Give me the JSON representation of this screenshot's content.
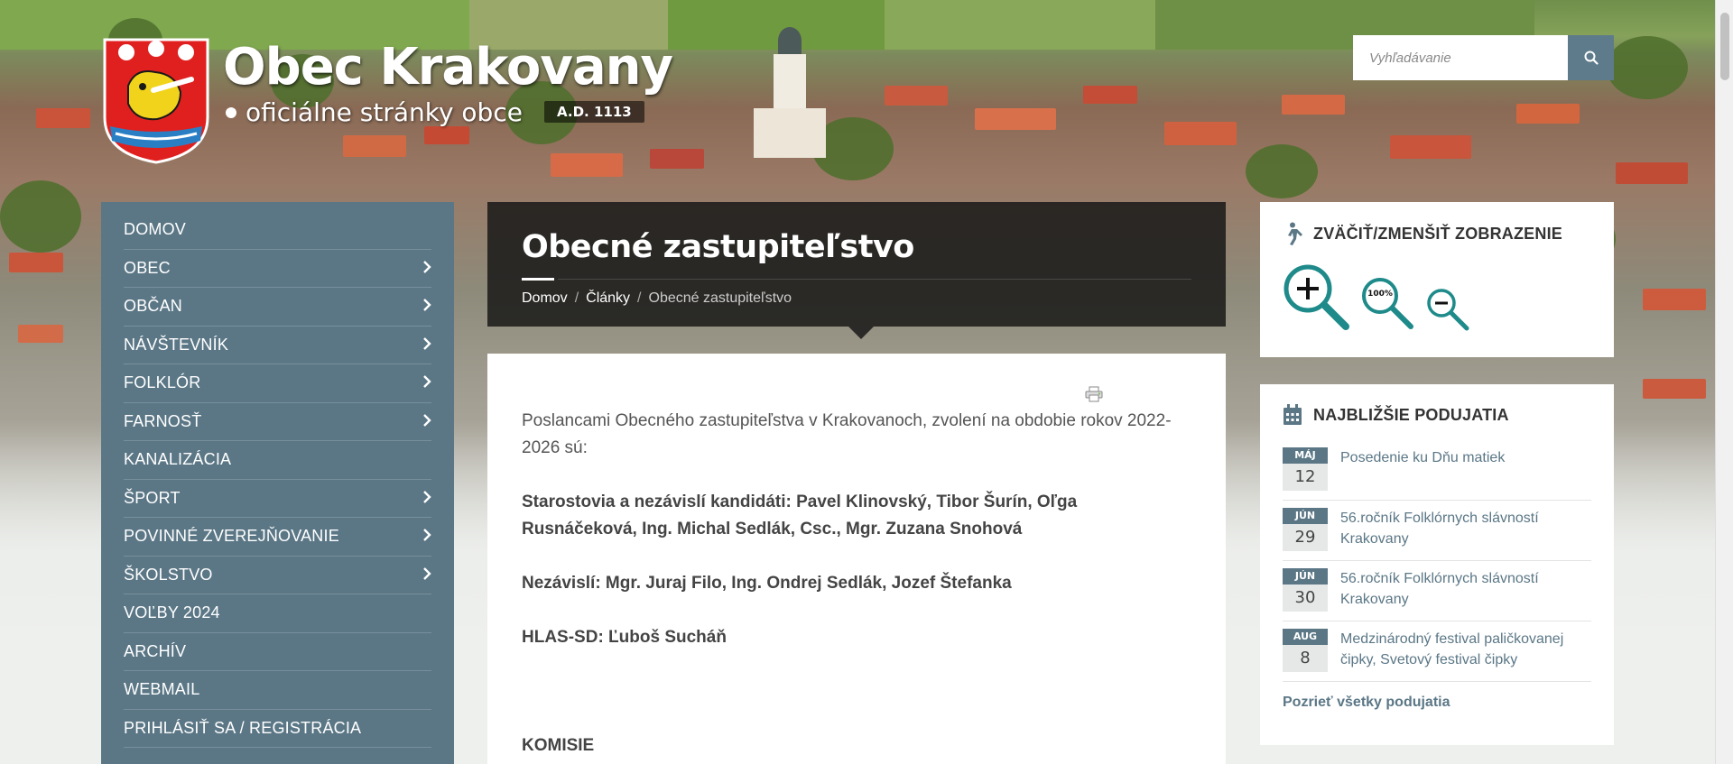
{
  "header": {
    "title": "Obec Krakovany",
    "subtitle": "oficiálne stránky obce",
    "badge": "A.D. 1113"
  },
  "search": {
    "placeholder": "Vyhľadávanie"
  },
  "nav": {
    "items": [
      {
        "label": "DOMOV",
        "sub": false
      },
      {
        "label": "OBEC",
        "sub": true
      },
      {
        "label": "OBČAN",
        "sub": true
      },
      {
        "label": "NÁVŠTEVNÍK",
        "sub": true
      },
      {
        "label": "FOLKLÓR",
        "sub": true
      },
      {
        "label": "FARNOSŤ",
        "sub": true
      },
      {
        "label": "KANALIZÁCIA",
        "sub": false
      },
      {
        "label": "ŠPORT",
        "sub": true
      },
      {
        "label": "POVINNÉ ZVEREJŇOVANIE",
        "sub": true
      },
      {
        "label": "ŠKOLSTVO",
        "sub": true
      },
      {
        "label": "VOĽBY 2024",
        "sub": false
      },
      {
        "label": "ARCHÍV",
        "sub": false
      },
      {
        "label": "WEBMAIL",
        "sub": false
      },
      {
        "label": "PRIHLÁSIŤ SA / REGISTRÁCIA",
        "sub": false
      }
    ]
  },
  "page": {
    "title": "Obecné zastupiteľstvo",
    "breadcrumb": [
      "Domov",
      "Články",
      "Obecné zastupiteľstvo"
    ],
    "intro": "Poslancami Obecného zastupiteľstva v Krakovanoch, zvolení na obdobie rokov 2022-2026 sú:",
    "p1": "Starostovia a nezávislí kandidáti: Pavel Klinovský, Tibor Šurín, Oľga Rusnáčeková, Ing. Michal Sedlák, Csc., Mgr. Zuzana Snohová",
    "p2": "Nezávislí: Mgr. Juraj Filo, Ing. Ondrej Sedlák, Jozef Štefanka",
    "p3": "HLAS-SD: Ľuboš Sucháň",
    "p4": "KOMISIE"
  },
  "zoom": {
    "title": "ZVÄČIŤ/ZMENŠIŤ ZOBRAZENIE",
    "reset_label": "100%"
  },
  "events": {
    "title": "NAJBLIŽŠIE PODUJATIA",
    "items": [
      {
        "month": "MÁJ",
        "day": "12",
        "title": "Posedenie ku Dňu matiek"
      },
      {
        "month": "JÚN",
        "day": "29",
        "title": "56.ročník Folklórnych slávností Krakovany"
      },
      {
        "month": "JÚN",
        "day": "30",
        "title": "56.ročník Folklórnych slávností Krakovany"
      },
      {
        "month": "AUG",
        "day": "8",
        "title": "Medzinárodný festival paličkovanej čipky, Svetový festival čipky"
      }
    ],
    "all_label": "Pozrieť všetky podujatia"
  },
  "colors": {
    "accent": "#5b7786",
    "header_dark": "#141414"
  }
}
